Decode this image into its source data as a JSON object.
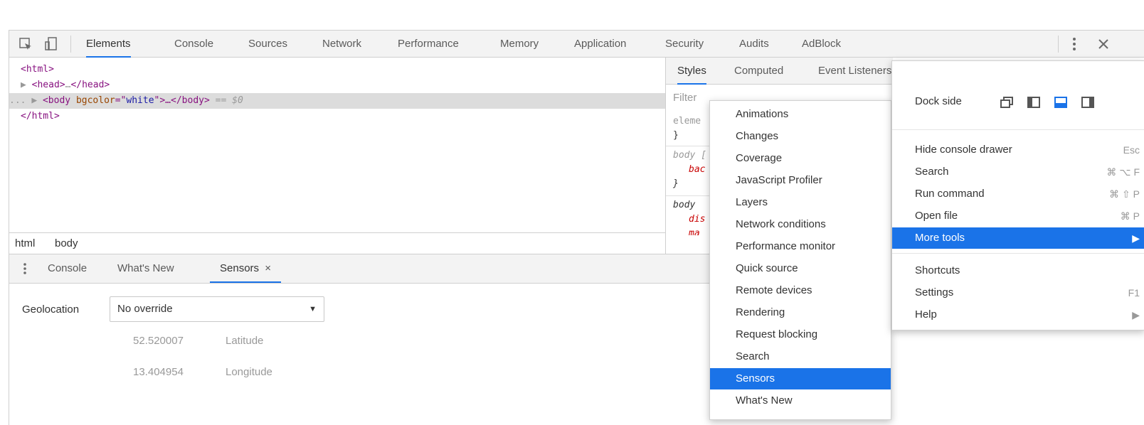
{
  "toolbar": {
    "tabs": [
      "Elements",
      "Console",
      "Sources",
      "Network",
      "Performance",
      "Memory",
      "Application",
      "Security",
      "Audits",
      "AdBlock"
    ],
    "more_icon": "vertical-ellipsis-icon",
    "close_icon": "close-icon",
    "accent_color": "#1a73e8"
  },
  "elements": {
    "line1": "<html>",
    "line2_open": "<head>",
    "line2_ellipsis": "…",
    "line2_close": "</head>",
    "line3_prefix": "...",
    "line3_tag": "<body",
    "line3_attr": "bgcolor",
    "line3_eq": "=\"",
    "line3_val": "white",
    "line3_rest": "\">…</body>",
    "line3_marker": "== $0",
    "line4": "</html>"
  },
  "breadcrumb": [
    "html",
    "body"
  ],
  "styles": {
    "tabs": [
      "Styles",
      "Computed",
      "Event Listeners"
    ],
    "filter_placeholder": "Filter",
    "rule_lines": [
      "eleme",
      "}",
      "body [",
      "bac",
      "}",
      "body",
      "dis",
      "ma"
    ]
  },
  "drawer": {
    "tabs": [
      "Console",
      "What's New",
      "Sensors"
    ],
    "close_glyph": "×",
    "geolocation_label": "Geolocation",
    "geolocation_value": "No override",
    "latitude_value": "52.520007",
    "latitude_label": "Latitude",
    "longitude_value": "13.404954",
    "longitude_label": "Longitude"
  },
  "more_tools_menu": {
    "items": [
      "Animations",
      "Changes",
      "Coverage",
      "JavaScript Profiler",
      "Layers",
      "Network conditions",
      "Performance monitor",
      "Quick source",
      "Remote devices",
      "Rendering",
      "Request blocking",
      "Search",
      "Sensors",
      "What's New"
    ],
    "highlighted": "Sensors"
  },
  "main_menu": {
    "dock_side_label": "Dock side",
    "items": [
      {
        "label": "Hide console drawer",
        "shortcut": "Esc"
      },
      {
        "label": "Search",
        "shortcut": "⌘ ⌥ F"
      },
      {
        "label": "Run command",
        "shortcut": "⌘ ⇧ P"
      },
      {
        "label": "Open file",
        "shortcut": "⌘ P"
      },
      {
        "label": "More tools",
        "shortcut": "▶"
      },
      {
        "label": "Shortcuts",
        "shortcut": ""
      },
      {
        "label": "Settings",
        "shortcut": "F1"
      },
      {
        "label": "Help",
        "shortcut": "▶"
      }
    ],
    "highlighted": "More tools"
  }
}
